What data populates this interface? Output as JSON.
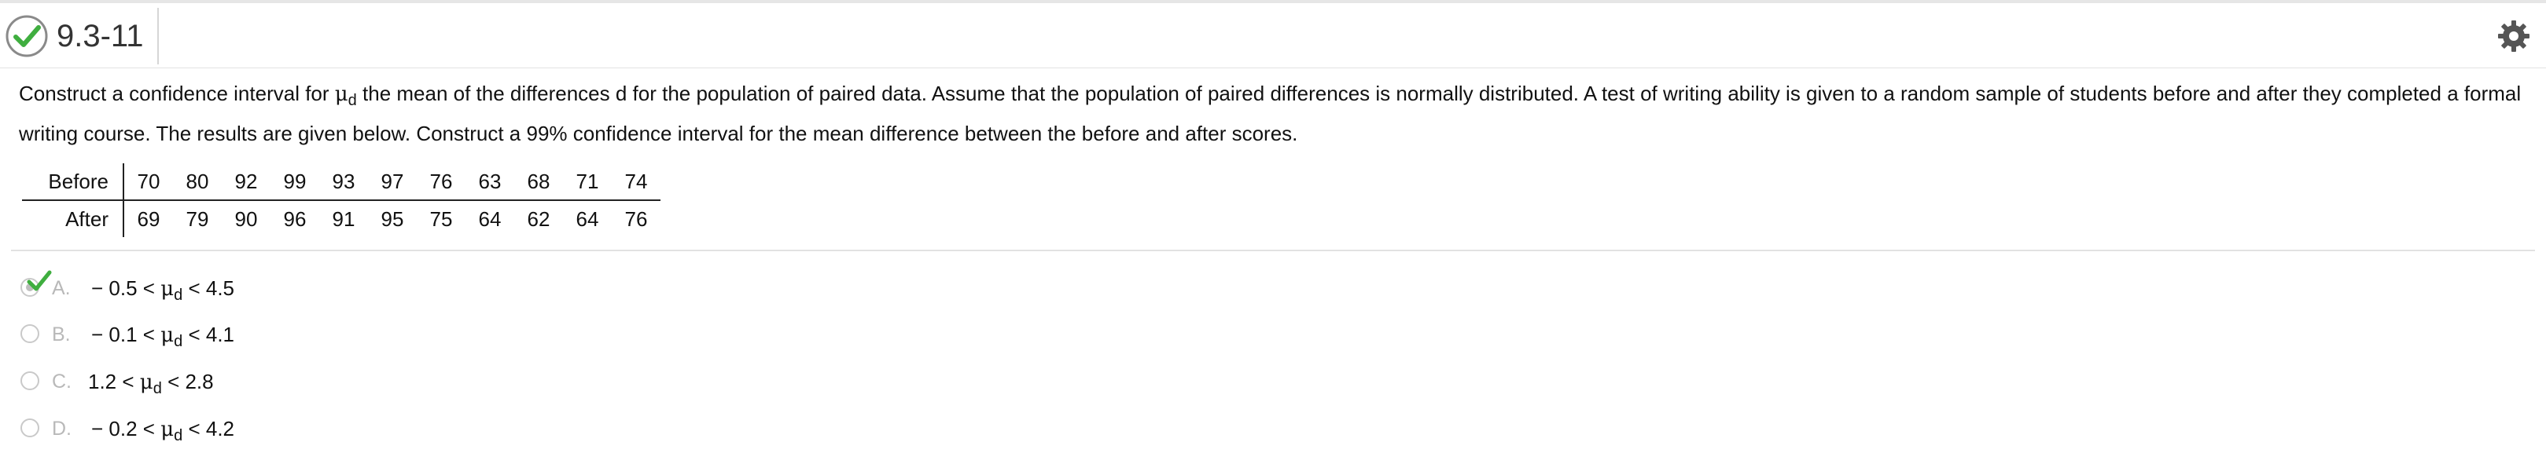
{
  "header": {
    "question_number": "9.3-11"
  },
  "question": {
    "part1": "Construct a confidence interval for ",
    "mu": "μ",
    "sub": "d",
    "part2": " the mean of the differences d for the population of paired data. Assume that the population of paired differences is normally distributed. A test of writing ability is given to a random sample of students before and after they completed a formal writing course. The results are given below. Construct a 99% confidence interval for the mean difference between the before and after scores."
  },
  "table": {
    "rows": [
      {
        "label": "Before",
        "values": [
          "70",
          "80",
          "92",
          "99",
          "93",
          "97",
          "76",
          "63",
          "68",
          "71",
          "74"
        ]
      },
      {
        "label": "After",
        "values": [
          "69",
          "79",
          "90",
          "96",
          "91",
          "95",
          "75",
          "64",
          "62",
          "64",
          "76"
        ]
      }
    ]
  },
  "choices": [
    {
      "letter": "A.",
      "low": "− 0.5 <",
      "mu": "μ",
      "sub": "d",
      "high": "< 4.5",
      "selected": true,
      "correct": true
    },
    {
      "letter": "B.",
      "low": "− 0.1 <",
      "mu": "μ",
      "sub": "d",
      "high": "< 4.1",
      "selected": false
    },
    {
      "letter": "C.",
      "low": "1.2 <",
      "mu": "μ",
      "sub": "d",
      "high": "< 2.8",
      "selected": false
    },
    {
      "letter": "D.",
      "low": "− 0.2 <",
      "mu": "μ",
      "sub": "d",
      "high": "< 4.2",
      "selected": false
    }
  ],
  "icons": {
    "status": "check-circle-icon",
    "settings": "gear-icon"
  },
  "colors": {
    "correct_green": "#3fae3f",
    "muted_gray": "#b9b9b9"
  }
}
